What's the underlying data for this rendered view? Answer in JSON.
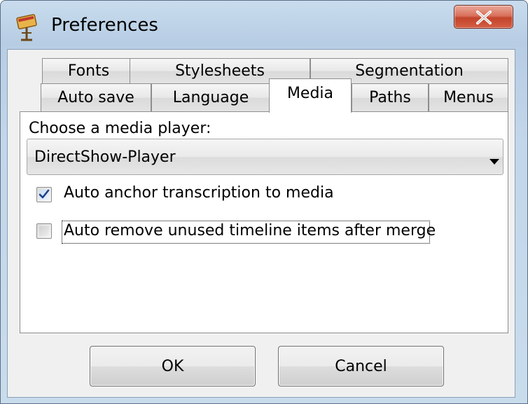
{
  "window": {
    "title": "Preferences",
    "icon": "preferences-app-icon",
    "close_icon": "close-icon"
  },
  "tabs": {
    "row_top": [
      {
        "label": "Fonts"
      },
      {
        "label": "Stylesheets"
      },
      {
        "label": "Segmentation"
      }
    ],
    "row_bottom": [
      {
        "label": "Auto save"
      },
      {
        "label": "Language"
      },
      {
        "label": "Media",
        "selected": true
      },
      {
        "label": "Paths"
      },
      {
        "label": "Menus"
      }
    ]
  },
  "media": {
    "choose_label": "Choose a media player:",
    "player_value": "DirectShow-Player",
    "options": [
      {
        "label": "Auto anchor transcription to media",
        "checked": true
      },
      {
        "label": "Auto remove unused timeline items after merge",
        "checked": false
      }
    ]
  },
  "buttons": {
    "ok_label": "OK",
    "cancel_label": "Cancel"
  },
  "colors": {
    "close_button": "#c94a32",
    "checkbox_check": "#1e3f8a",
    "window_frame": "#b9d1ea"
  }
}
